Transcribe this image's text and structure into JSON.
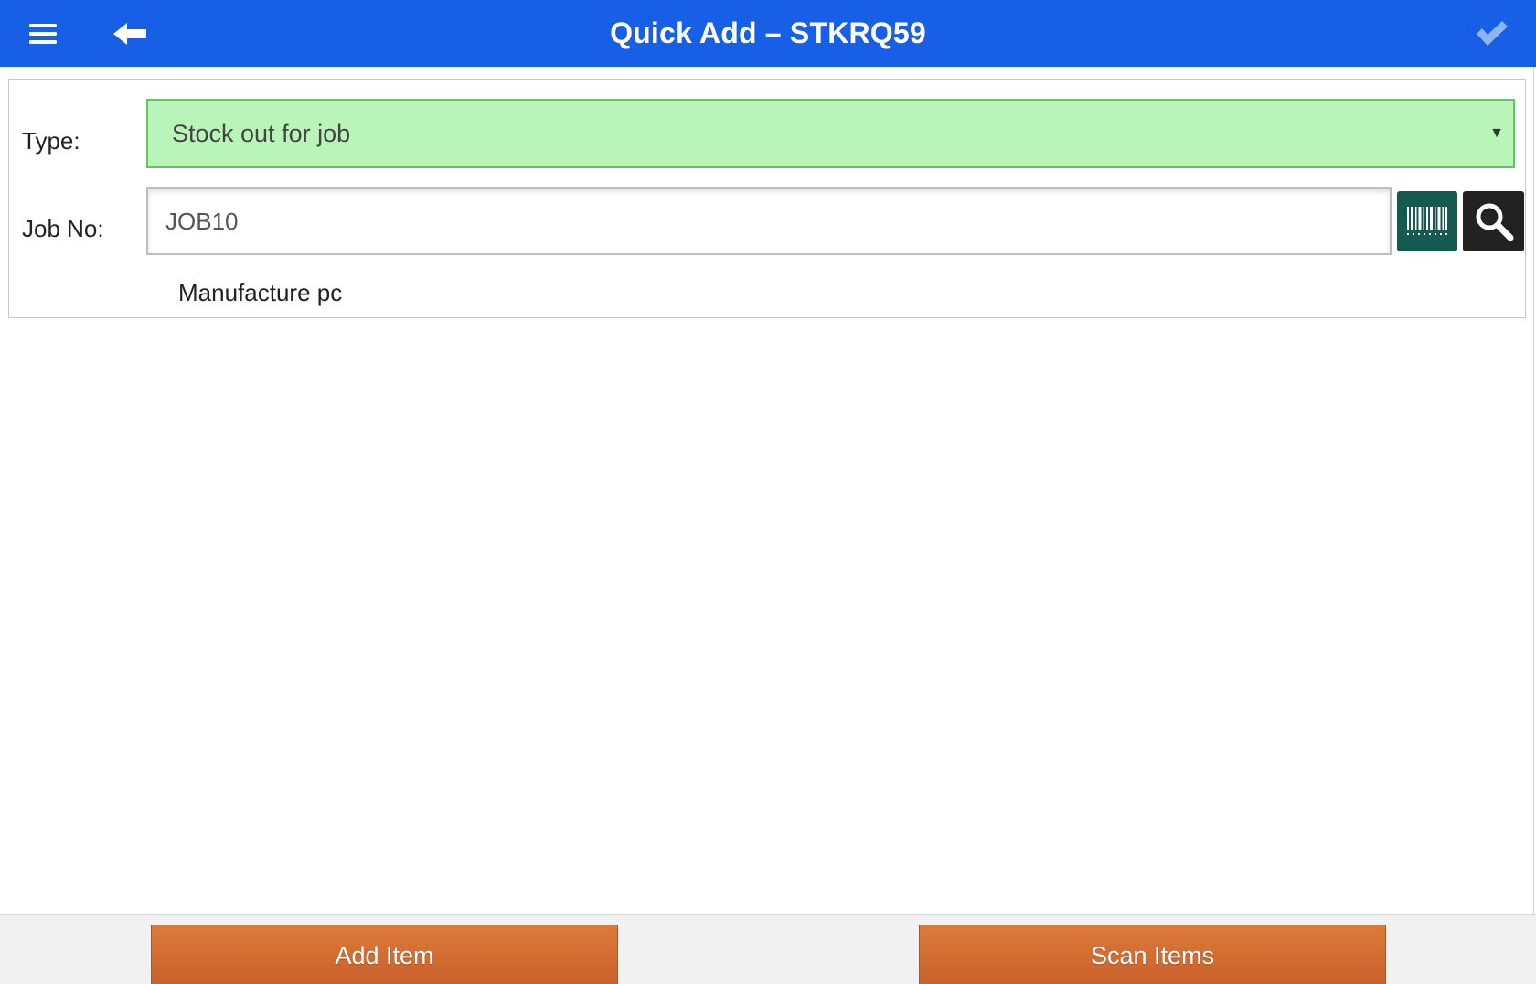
{
  "header": {
    "title": "Quick Add – STKRQ59",
    "menu_icon": "hamburger-menu-icon",
    "back_icon": "back-arrow-icon",
    "done_icon": "checkmark-icon",
    "background_color": "#175fe6"
  },
  "form": {
    "type_label": "Type:",
    "type_value": "Stock out for job",
    "type_field_color": "#b9f5b9",
    "job_label": "Job No:",
    "job_value": "JOB10",
    "job_description": "Manufacture pc",
    "barcode_icon": "barcode-icon",
    "search_icon": "search-icon"
  },
  "footer": {
    "add_item_label": "Add Item",
    "scan_items_label": "Scan Items",
    "button_color": "#d06a30"
  }
}
